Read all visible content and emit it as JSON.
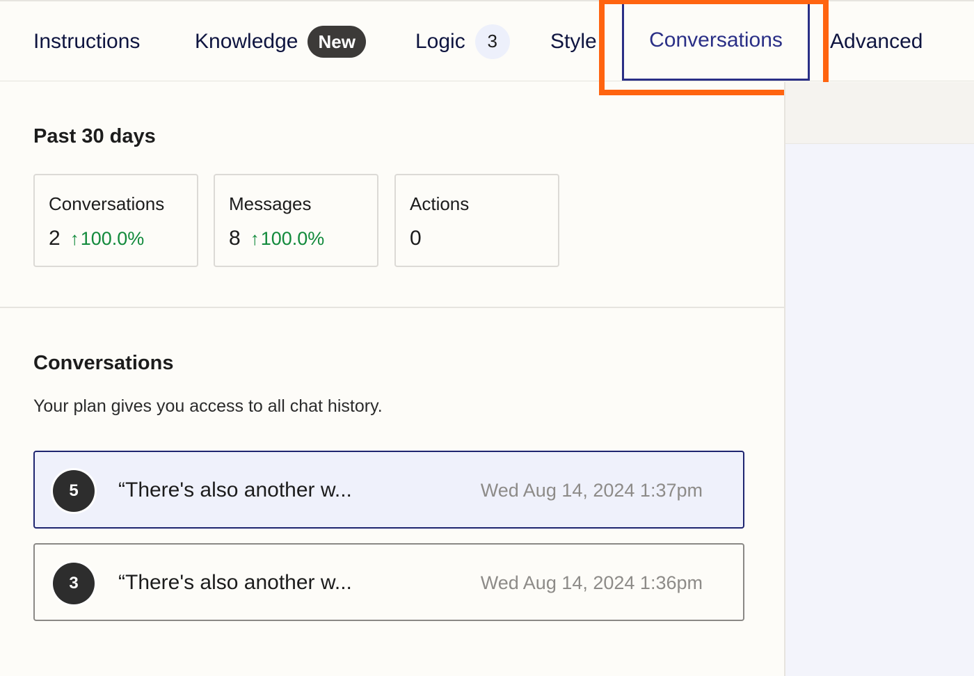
{
  "tabs": [
    {
      "label": "Instructions"
    },
    {
      "label": "Knowledge",
      "badge": "New"
    },
    {
      "label": "Logic",
      "badge": "3"
    },
    {
      "label": "Style"
    },
    {
      "label": "Conversations",
      "active": true
    },
    {
      "label": "Advanced"
    }
  ],
  "highlight_color": "#ff6410",
  "stats": {
    "title": "Past 30 days",
    "cards": [
      {
        "title": "Conversations",
        "value": "2",
        "change_arrow": "↑",
        "change": "100.0%"
      },
      {
        "title": "Messages",
        "value": "8",
        "change_arrow": "↑",
        "change": "100.0%"
      },
      {
        "title": "Actions",
        "value": "0"
      }
    ]
  },
  "conversations": {
    "title": "Conversations",
    "subtitle": "Your plan gives you access to all chat history.",
    "items": [
      {
        "count": "5",
        "preview": "“There's also another w...",
        "timestamp": "Wed Aug 14, 2024 1:37pm",
        "selected": true
      },
      {
        "count": "3",
        "preview": "“There's also another w...",
        "timestamp": "Wed Aug 14, 2024 1:36pm",
        "selected": false
      }
    ]
  }
}
